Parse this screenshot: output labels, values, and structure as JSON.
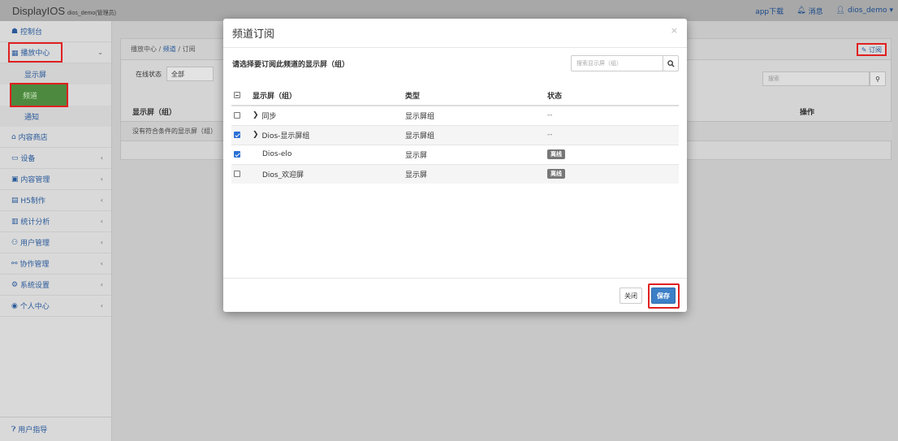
{
  "topbar": {
    "brand": "DisplayIOS",
    "brand_sub": "dios_demo(管理员)",
    "app_download": "app下载",
    "messages": "消息",
    "user": "dios_demo"
  },
  "sidebar": {
    "items": [
      {
        "label": "控制台",
        "caret": ""
      },
      {
        "label": "播放中心",
        "caret": "⌄"
      },
      {
        "label": "内容商店",
        "caret": ""
      },
      {
        "label": "设备",
        "caret": "‹"
      },
      {
        "label": "内容管理",
        "caret": "‹"
      },
      {
        "label": "H5制作",
        "caret": "‹"
      },
      {
        "label": "统计分析",
        "caret": "‹"
      },
      {
        "label": "用户管理",
        "caret": "‹"
      },
      {
        "label": "协作管理",
        "caret": "‹"
      },
      {
        "label": "系统设置",
        "caret": "‹"
      },
      {
        "label": "个人中心",
        "caret": "‹"
      }
    ],
    "sub_items": [
      "显示屏",
      "频道",
      "通知"
    ],
    "guide": "用户指导"
  },
  "main": {
    "breadcrumb": [
      "播放中心",
      "频道",
      "订阅"
    ],
    "subscribe_button": "✎ 订阅",
    "filter_label": "在线状态",
    "filter_value": "全部",
    "search_placeholder": "搜索",
    "col_display": "显示屏（组）",
    "col_actions": "操作",
    "empty_text": "没有符合条件的显示屏（组）"
  },
  "modal": {
    "title": "频道订阅",
    "close": "×",
    "prompt": "请选择要订阅此频道的显示屏（组）",
    "search_placeholder": "搜索显示屏（组）",
    "headers": {
      "name": "显示屏（组）",
      "type": "类型",
      "status": "状态"
    },
    "rows": [
      {
        "name": "同步",
        "type": "显示屏组",
        "status": "--",
        "checked": false,
        "group": true
      },
      {
        "name": "Dios-显示屏组",
        "type": "显示屏组",
        "status": "--",
        "checked": true,
        "group": true
      },
      {
        "name": "Dios-elo",
        "type": "显示屏",
        "status": "离线",
        "checked": true,
        "group": false
      },
      {
        "name": "Dios_欢迎屏",
        "type": "显示屏",
        "status": "离线",
        "checked": false,
        "group": false
      }
    ],
    "btn_close": "关闭",
    "btn_save": "保存"
  },
  "colors": {
    "accent": "#3c7fc6",
    "active_menu": "#4d8a40",
    "highlight": "#e02020",
    "badge": "#777777"
  }
}
